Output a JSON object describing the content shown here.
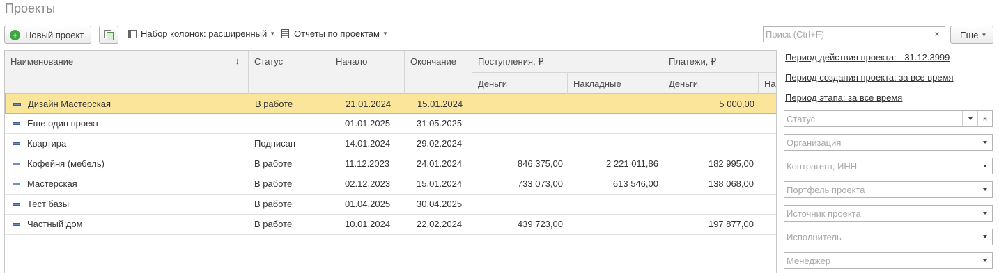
{
  "page": {
    "title": "Проекты"
  },
  "toolbar": {
    "new_label": "Новый проект",
    "columns_label": "Набор колонок: расширенный",
    "reports_label": "Отчеты по проектам",
    "search_placeholder": "Поиск (Ctrl+F)",
    "search_clear": "×",
    "more_label": "Еще"
  },
  "table": {
    "headers": {
      "name": "Наименование",
      "sort": "↓",
      "status": "Статус",
      "start": "Начало",
      "end": "Окончание",
      "income": "Поступления, ₽",
      "income_money": "Деньги",
      "income_invoices": "Накладные",
      "payments": "Платежи, ₽",
      "payments_money": "Деньги",
      "payments_invoices": "На"
    },
    "rows": [
      {
        "name": "Дизайн Мастерская",
        "status": "В работе",
        "start": "21.01.2024",
        "end": "15.01.2024",
        "income_money": "",
        "income_invoices": "",
        "payments_money": "5 000,00"
      },
      {
        "name": "Еще один проект",
        "status": "",
        "start": "01.01.2025",
        "end": "31.05.2025",
        "income_money": "",
        "income_invoices": "",
        "payments_money": ""
      },
      {
        "name": "Квартира",
        "status": "Подписан",
        "start": "14.01.2024",
        "end": "29.02.2024",
        "income_money": "",
        "income_invoices": "",
        "payments_money": ""
      },
      {
        "name": "Кофейня (мебель)",
        "status": "В работе",
        "start": "11.12.2023",
        "end": "24.01.2024",
        "income_money": "846 375,00",
        "income_invoices": "2 221 011,86",
        "payments_money": "182 995,00"
      },
      {
        "name": "Мастерская",
        "status": "В работе",
        "start": "02.12.2023",
        "end": "15.01.2024",
        "income_money": "733 073,00",
        "income_invoices": "613 546,00",
        "payments_money": "138 068,00"
      },
      {
        "name": "Тест базы",
        "status": "В работе",
        "start": "01.04.2025",
        "end": "30.04.2025",
        "income_money": "",
        "income_invoices": "",
        "payments_money": ""
      },
      {
        "name": "Частный дом",
        "status": "В работе",
        "start": "10.01.2024",
        "end": "22.02.2024",
        "income_money": "439 723,00",
        "income_invoices": "",
        "payments_money": "197 877,00"
      }
    ]
  },
  "filters": {
    "period_project": "Период действия проекта:  - 31.12.3999",
    "period_created": "Период создания проекта: за все время",
    "period_stage": "Период этапа: за все время",
    "clear_symbol": "×",
    "fields": {
      "status": "Статус",
      "organization": "Организация",
      "counterparty": "Контрагент, ИНН",
      "portfolio": "Портфель проекта",
      "source": "Источник проекта",
      "executor": "Исполнитель",
      "manager": "Менеджер"
    }
  }
}
